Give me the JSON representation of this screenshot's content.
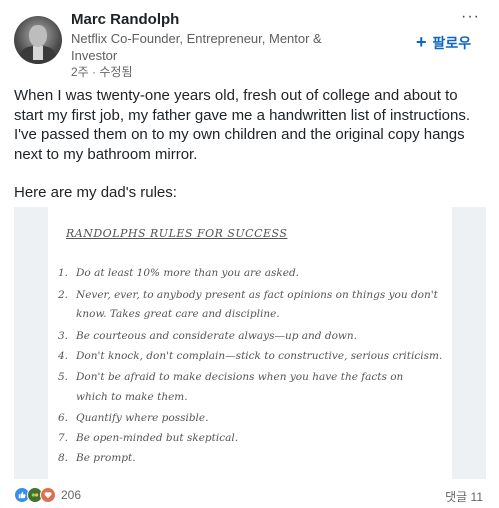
{
  "author": {
    "name": "Marc Randolph",
    "headline": "Netflix Co-Founder, Entrepreneur, Mentor & Investor",
    "timestamp": "2주 · 수정됨"
  },
  "actions": {
    "more_label": "···",
    "follow_plus": "+",
    "follow_label": "팔로우"
  },
  "post": {
    "paragraph1": "When I was twenty-one years old, fresh out of college and about to start my first job, my father gave me a handwritten list of instructions. I've passed them on to my own children and the original copy hangs next to my bathroom mirror.",
    "paragraph2": "Here are my dad's rules:"
  },
  "image": {
    "title": "RANDOLPHS RULES FOR SUCCESS",
    "rules": [
      {
        "num": "1.",
        "lines": [
          "Do at least 10% more than you are asked."
        ]
      },
      {
        "num": "2.",
        "lines": [
          "Never, ever, to anybody present as fact opinions on things you don't",
          "know. Takes great care and discipline."
        ]
      },
      {
        "num": "3.",
        "lines": [
          "Be courteous and considerate always—up and down."
        ]
      },
      {
        "num": "4.",
        "lines": [
          "Don't knock, don't complain—stick to constructive, serious criticism."
        ]
      },
      {
        "num": "5.",
        "lines": [
          "Don't be afraid to make decisions when you have the facts on",
          "which to make them."
        ]
      },
      {
        "num": "6.",
        "lines": [
          "Quantify where possible."
        ]
      },
      {
        "num": "7.",
        "lines": [
          "Be open-minded but skeptical."
        ]
      },
      {
        "num": "8.",
        "lines": [
          "Be prompt."
        ]
      }
    ]
  },
  "social": {
    "reaction_icons": [
      "like-icon",
      "celebrate-icon",
      "love-icon"
    ],
    "reaction_count": "206",
    "comments": "댓글 11"
  }
}
